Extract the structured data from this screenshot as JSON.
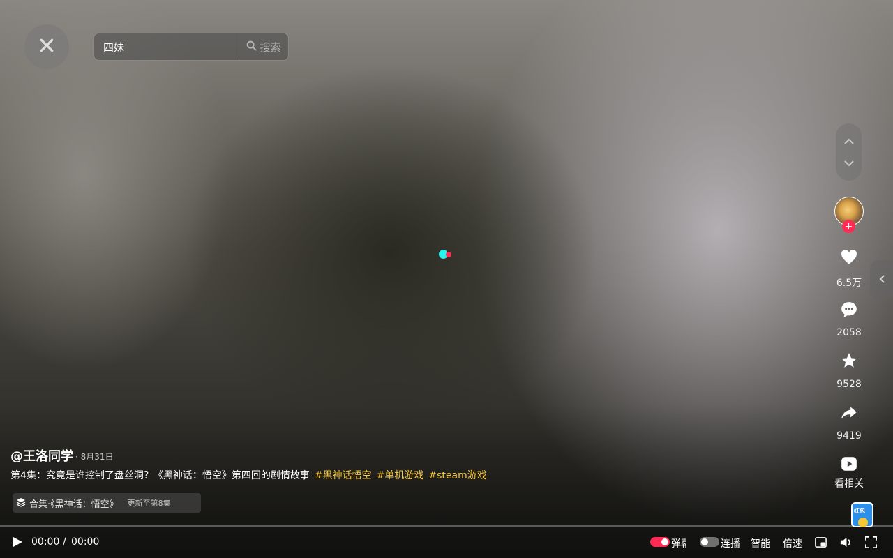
{
  "search": {
    "value": "四妹",
    "button_label": "搜索"
  },
  "author": {
    "handle": "@王洛同学",
    "date": "· 8月31日"
  },
  "caption": {
    "text": "第4集：究竟是谁控制了盘丝洞？《黑神话：悟空》第四回的剧情故事",
    "hashtags": [
      "#黑神话悟空",
      "#单机游戏",
      "#steam游戏"
    ]
  },
  "collection": {
    "title": "合集·《黑神话：悟空》",
    "update": "更新至第8集"
  },
  "stats": {
    "likes": "6.5万",
    "comments": "2058",
    "favorites": "9528",
    "shares": "9419",
    "related_label": "看相关"
  },
  "player": {
    "current_time": "00:00",
    "separator": "/",
    "duration": "00:00",
    "progress_fraction": 0,
    "danmu_label": "弹幕",
    "autoplay_label": "连播",
    "quality_label": "智能",
    "speed_label": "倍速",
    "danmu_on": true,
    "autoplay_on": false
  },
  "promo": {
    "badge_text": "红包"
  },
  "colors": {
    "accent": "#fe2c55",
    "hashtag": "#f5c842",
    "loader_cyan": "#25f4ee"
  },
  "icons": [
    "close-icon",
    "search-icon",
    "chevron-up-icon",
    "chevron-down-icon",
    "follow-plus-icon",
    "heart-icon",
    "comment-icon",
    "star-icon",
    "share-icon",
    "related-play-icon",
    "chevron-left-icon",
    "collection-stack-icon",
    "play-icon",
    "picture-in-picture-icon",
    "volume-icon",
    "fullscreen-icon"
  ]
}
